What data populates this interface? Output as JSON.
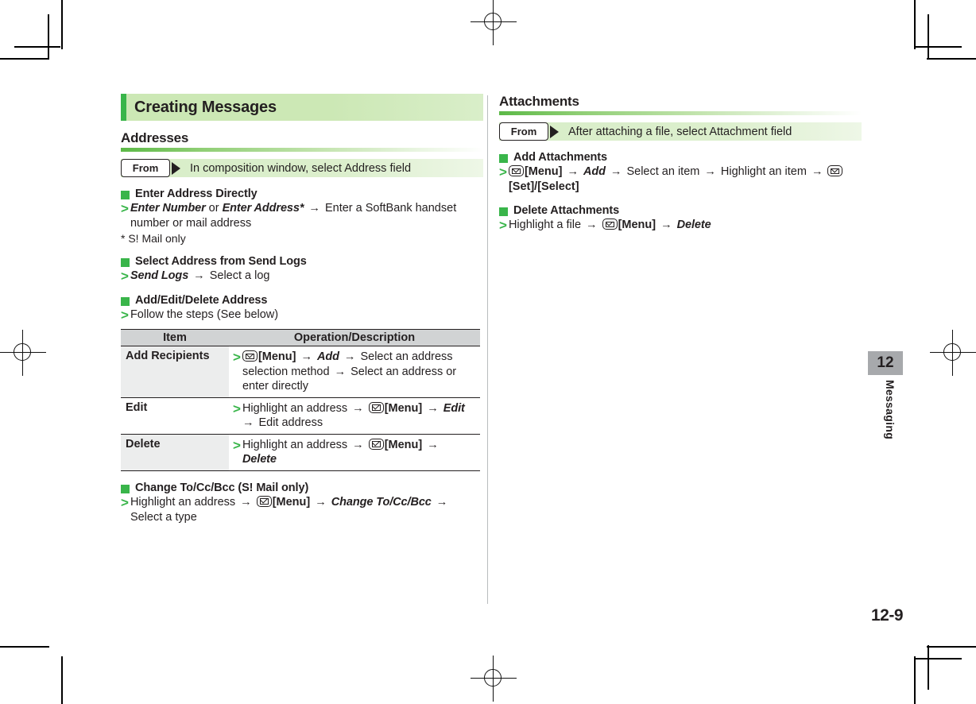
{
  "page": {
    "number": "12-9",
    "chapter_number": "12",
    "chapter_label": "Messaging"
  },
  "colors": {
    "accent_green": "#39b54a",
    "bar_green": "#cce8b5",
    "strip_green": "#d8eec8",
    "table_header_gray": "#d1d3d4",
    "tab_gray": "#a7a9ac",
    "text": "#231f20"
  },
  "left_column": {
    "chapter_title": "Creating Messages",
    "section_title": "Addresses",
    "from_row": {
      "badge": "From",
      "text": "In composition window, select Address field"
    },
    "blocks": [
      {
        "heading": "Enter Address Directly",
        "steps": [
          {
            "parts": [
              {
                "t": "Enter Number",
                "s": "bi"
              },
              {
                "t": " or ",
                "s": "n"
              },
              {
                "t": "Enter Address*",
                "s": "bi"
              },
              {
                "t": " → ",
                "s": "arw"
              },
              {
                "t": "Enter a SoftBank handset number or mail address",
                "s": "n"
              }
            ]
          }
        ],
        "note": "* S! Mail only"
      },
      {
        "heading": "Select Address from Send Logs",
        "steps": [
          {
            "parts": [
              {
                "t": "Send Logs",
                "s": "bi"
              },
              {
                "t": " → ",
                "s": "arw"
              },
              {
                "t": "Select a log",
                "s": "n"
              }
            ]
          }
        ],
        "note": ""
      },
      {
        "heading": "Add/Edit/Delete Address",
        "steps": [
          {
            "parts": [
              {
                "t": "Follow the steps (See below)",
                "s": "n"
              }
            ]
          }
        ],
        "note": ""
      }
    ],
    "table": {
      "headers": [
        "Item",
        "Operation/Description"
      ],
      "rows": [
        {
          "item": "Add Recipients",
          "desc_parts": [
            {
              "t": "",
              "s": "env"
            },
            {
              "t": "[Menu]",
              "s": "b"
            },
            {
              "t": " → ",
              "s": "arw"
            },
            {
              "t": "Add",
              "s": "bi"
            },
            {
              "t": " → ",
              "s": "arw"
            },
            {
              "t": "Select an address selection method",
              "s": "n"
            },
            {
              "t": " → ",
              "s": "arw"
            },
            {
              "t": "Select an address or enter directly",
              "s": "n"
            }
          ]
        },
        {
          "item": "Edit",
          "desc_parts": [
            {
              "t": "Highlight an address",
              "s": "n"
            },
            {
              "t": " → ",
              "s": "arw"
            },
            {
              "t": "",
              "s": "env"
            },
            {
              "t": "[Menu]",
              "s": "b"
            },
            {
              "t": " → ",
              "s": "arw"
            },
            {
              "t": "Edit",
              "s": "bi"
            },
            {
              "t": " → ",
              "s": "arw"
            },
            {
              "t": "Edit address",
              "s": "n"
            }
          ]
        },
        {
          "item": "Delete",
          "desc_parts": [
            {
              "t": "Highlight an address",
              "s": "n"
            },
            {
              "t": " → ",
              "s": "arw"
            },
            {
              "t": "",
              "s": "env"
            },
            {
              "t": "[Menu]",
              "s": "b"
            },
            {
              "t": " → ",
              "s": "arw"
            },
            {
              "t": "Delete",
              "s": "bi"
            }
          ]
        }
      ]
    },
    "trailing_blocks": [
      {
        "heading": "Change To/Cc/Bcc (S! Mail only)",
        "steps": [
          {
            "parts": [
              {
                "t": "Highlight an address",
                "s": "n"
              },
              {
                "t": " → ",
                "s": "arw"
              },
              {
                "t": "",
                "s": "env"
              },
              {
                "t": "[Menu]",
                "s": "b"
              },
              {
                "t": " → ",
                "s": "arw"
              },
              {
                "t": "Change To/Cc/Bcc",
                "s": "bi"
              },
              {
                "t": " → ",
                "s": "arw"
              },
              {
                "t": "Select a type",
                "s": "n"
              }
            ]
          }
        ],
        "note": ""
      }
    ]
  },
  "right_column": {
    "section_title": "Attachments",
    "from_row": {
      "badge": "From",
      "text": "After attaching a file, select Attachment field"
    },
    "blocks": [
      {
        "heading": "Add Attachments",
        "steps": [
          {
            "parts": [
              {
                "t": "",
                "s": "env"
              },
              {
                "t": "[Menu]",
                "s": "b"
              },
              {
                "t": " → ",
                "s": "arw"
              },
              {
                "t": "Add",
                "s": "bi"
              },
              {
                "t": " → ",
                "s": "arw"
              },
              {
                "t": "Select an item",
                "s": "n"
              },
              {
                "t": " → ",
                "s": "arw"
              },
              {
                "t": "Highlight an item",
                "s": "n"
              },
              {
                "t": " → ",
                "s": "arw"
              },
              {
                "t": "",
                "s": "env"
              },
              {
                "t": "[Set]/",
                "s": "b"
              },
              {
                "t": "[Select]",
                "s": "b"
              }
            ]
          }
        ],
        "note": ""
      },
      {
        "heading": "Delete Attachments",
        "steps": [
          {
            "parts": [
              {
                "t": "Highlight a file",
                "s": "n"
              },
              {
                "t": " → ",
                "s": "arw"
              },
              {
                "t": "",
                "s": "env"
              },
              {
                "t": "[Menu]",
                "s": "b"
              },
              {
                "t": " → ",
                "s": "arw"
              },
              {
                "t": "Delete",
                "s": "bi"
              }
            ]
          }
        ],
        "note": ""
      }
    ]
  }
}
